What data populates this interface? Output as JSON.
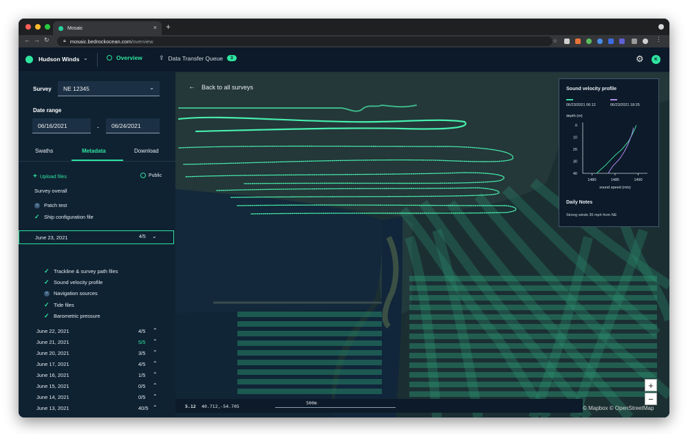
{
  "browser": {
    "tab_title": "Mosaic",
    "url_host": "mosaic.bedrockocean.com",
    "url_path": "/overview",
    "colors": {
      "close": "#ff5f57",
      "minimize": "#febc2e",
      "maximize": "#28c840"
    },
    "extensions": [
      "#7ab8ff",
      "#e8733a",
      "#5bbf5f",
      "#4b8de8",
      "#3d6be0",
      "#5f5fd4",
      "#9a9a9a"
    ]
  },
  "header": {
    "org_name": "Hudson Winds",
    "nav_overview": "Overview",
    "nav_queue": "Data Transfer Queue",
    "queue_count": "3",
    "avatar_initial": "K"
  },
  "sidebar": {
    "survey_label": "Survey",
    "survey_value": "NE 12345",
    "date_range_label": "Date range",
    "date_start": "06/16/2021",
    "date_end": "06/24/2021",
    "date_sep": "-",
    "tabs": [
      "Swaths",
      "Metadata",
      "Download"
    ],
    "upload_label": "Upload files",
    "public_label": "Public",
    "survey_overall_label": "Survey overall",
    "overall_items": [
      {
        "label": "Patch test",
        "done": false
      },
      {
        "label": "Ship configuration file",
        "done": true
      }
    ],
    "expanded_date": {
      "label": "June 23, 2021",
      "count": "4/5"
    },
    "expanded_items": [
      {
        "label": "Trackline & survey path files",
        "done": true
      },
      {
        "label": "Sound velocity profile",
        "done": true
      },
      {
        "label": "Navigation sources",
        "done": false
      },
      {
        "label": "Tide files",
        "done": true
      },
      {
        "label": "Barometric pressure",
        "done": true
      }
    ],
    "dates": [
      {
        "label": "June 22, 2021",
        "count": "4/5",
        "done": false
      },
      {
        "label": "June 21, 2021",
        "count": "5/5",
        "done": true
      },
      {
        "label": "June 20, 2021",
        "count": "3/5",
        "done": false
      },
      {
        "label": "June 17, 2021",
        "count": "4/5",
        "done": false
      },
      {
        "label": "June 16, 2021",
        "count": "1/5",
        "done": false
      },
      {
        "label": "June 15, 2021",
        "count": "0/5",
        "done": false
      },
      {
        "label": "June 14, 2021",
        "count": "0/5",
        "done": false
      },
      {
        "label": "June 13, 2021",
        "count": "40/5",
        "done": false
      }
    ]
  },
  "map": {
    "back_label": "Back to all surveys",
    "zoom_level": "5.12",
    "coordinates": "40.712,-54.705",
    "scale_label": "500m",
    "zoom_in": "+",
    "zoom_out": "−",
    "attribution": "© Mapbox © OpenStreetMap"
  },
  "sound_velocity": {
    "title": "Sound velocity profile",
    "legend": [
      {
        "label": "06/23/2021 06:12",
        "color": "#3fdca5"
      },
      {
        "label": "06/23/2021 18:25",
        "color": "#b48cf0"
      }
    ],
    "daily_notes_title": "Daily Notes",
    "daily_notes_text": "Strong winds 35 mph from NE"
  },
  "chart_data": {
    "type": "line",
    "xlabel": "sound speed (m/s)",
    "ylabel": "depth (m)",
    "xlim": [
      1478,
      1492
    ],
    "ylim": [
      40,
      0
    ],
    "xticks": [
      1480,
      1485,
      1490
    ],
    "yticks": [
      0,
      10,
      20,
      30,
      40
    ],
    "series": [
      {
        "x": [
          1481,
          1483,
          1485,
          1486.5,
          1488,
          1488.8,
          1489.3,
          1489.6
        ],
        "y": [
          40,
          33,
          25,
          20,
          13,
          7,
          3,
          0
        ]
      },
      {
        "x": [
          1483.5,
          1484.5,
          1486,
          1487,
          1487.8,
          1488.6,
          1489
        ],
        "y": [
          40,
          34,
          28,
          22,
          16,
          8,
          2
        ]
      }
    ]
  }
}
